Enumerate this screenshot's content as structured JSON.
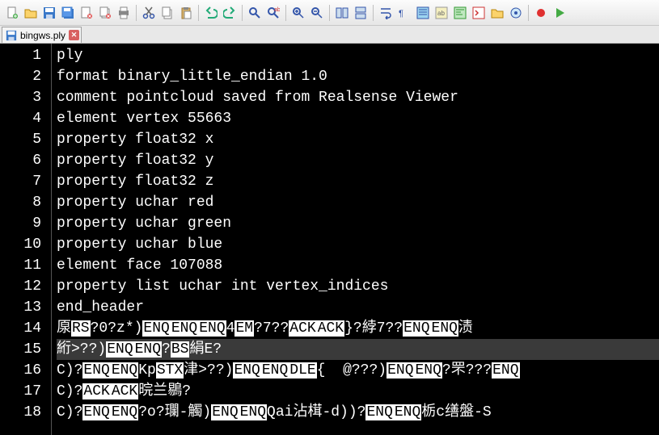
{
  "toolbar": {
    "icons": [
      "new-file-icon",
      "open-file-icon",
      "save-icon",
      "save-all-icon",
      "close-file-icon",
      "close-all-icon",
      "print-icon",
      "sep",
      "cut-icon",
      "copy-icon",
      "paste-icon",
      "sep",
      "undo-icon",
      "redo-icon",
      "sep",
      "find-icon",
      "replace-icon",
      "sep",
      "zoom-in-icon",
      "zoom-out-icon",
      "sep",
      "sync-scroll-icon",
      "sync-scroll-v-icon",
      "sep",
      "wrap-icon",
      "show-invisible-icon",
      "indent-guide-icon",
      "language-icon",
      "doc-map-icon",
      "function-list-icon",
      "folder-icon",
      "monitor-icon",
      "sep",
      "record-macro-icon",
      "play-macro-icon"
    ]
  },
  "tab": {
    "filename": "bingws.ply"
  },
  "editor": {
    "current_line": 15,
    "lines": [
      {
        "n": 1,
        "txt": "ply"
      },
      {
        "n": 2,
        "txt": "format binary_little_endian 1.0"
      },
      {
        "n": 3,
        "txt": "comment pointcloud saved from Realsense Viewer"
      },
      {
        "n": 4,
        "txt": "element vertex 55663"
      },
      {
        "n": 5,
        "txt": "property float32 x"
      },
      {
        "n": 6,
        "txt": "property float32 y"
      },
      {
        "n": 7,
        "txt": "property float32 z"
      },
      {
        "n": 8,
        "txt": "property uchar red"
      },
      {
        "n": 9,
        "txt": "property uchar green"
      },
      {
        "n": 10,
        "txt": "property uchar blue"
      },
      {
        "n": 11,
        "txt": "element face 107088"
      },
      {
        "n": 12,
        "txt": "property list uchar int vertex_indices"
      },
      {
        "n": 13,
        "txt": "end_header"
      },
      {
        "n": 14,
        "segs": [
          {
            "t": "厡",
            "i": 0
          },
          {
            "t": "RS",
            "i": 1
          },
          {
            "t": "?0?z*)",
            "i": 0
          },
          {
            "t": "ENQ",
            "i": 1
          },
          {
            "t": "ENQ",
            "i": 1
          },
          {
            "t": "ENQ",
            "i": 1
          },
          {
            "t": "4",
            "i": 0
          },
          {
            "t": "EM",
            "i": 1
          },
          {
            "t": "?7??",
            "i": 0
          },
          {
            "t": "ACK",
            "i": 1
          },
          {
            "t": "ACK",
            "i": 1
          },
          {
            "t": "}?綍7??",
            "i": 0
          },
          {
            "t": "ENQ",
            "i": 1
          },
          {
            "t": "ENQ",
            "i": 1
          },
          {
            "t": "渍",
            "i": 0
          }
        ]
      },
      {
        "n": 15,
        "segs": [
          {
            "t": "絎>??)",
            "i": 0
          },
          {
            "t": "ENQ",
            "i": 1
          },
          {
            "t": "ENQ",
            "i": 1
          },
          {
            "t": "?",
            "i": 0
          },
          {
            "t": "BS",
            "i": 1
          },
          {
            "t": "絹E?",
            "i": 0
          }
        ]
      },
      {
        "n": 16,
        "segs": [
          {
            "t": "C)?",
            "i": 0
          },
          {
            "t": "ENQ",
            "i": 1
          },
          {
            "t": "ENQ",
            "i": 1
          },
          {
            "t": "Kp",
            "i": 0
          },
          {
            "t": "STX",
            "i": 1
          },
          {
            "t": "津>??)",
            "i": 0
          },
          {
            "t": "ENQ",
            "i": 1
          },
          {
            "t": "ENQ",
            "i": 1
          },
          {
            "t": "DLE",
            "i": 1
          },
          {
            "t": "{  @???)",
            "i": 0
          },
          {
            "t": "ENQ",
            "i": 1
          },
          {
            "t": "ENQ",
            "i": 1
          },
          {
            "t": "?罘???",
            "i": 0
          },
          {
            "t": "ENQ",
            "i": 1
          }
        ]
      },
      {
        "n": 17,
        "segs": [
          {
            "t": "C)?",
            "i": 0
          },
          {
            "t": "ACK",
            "i": 1
          },
          {
            "t": "ACK",
            "i": 1
          },
          {
            "t": "晥兰鶍?",
            "i": 0
          }
        ]
      },
      {
        "n": 18,
        "segs": [
          {
            "t": "C)?",
            "i": 0
          },
          {
            "t": "ENQ",
            "i": 1
          },
          {
            "t": "ENQ",
            "i": 1
          },
          {
            "t": "?o?瓓-觸)",
            "i": 0
          },
          {
            "t": "ENQ",
            "i": 1
          },
          {
            "t": "ENQ",
            "i": 1
          },
          {
            "t": "Qai沾榵-d))?",
            "i": 0
          },
          {
            "t": "ENQ",
            "i": 1
          },
          {
            "t": "ENQ",
            "i": 1
          },
          {
            "t": "栃c缮盤-S",
            "i": 0
          }
        ]
      }
    ]
  }
}
